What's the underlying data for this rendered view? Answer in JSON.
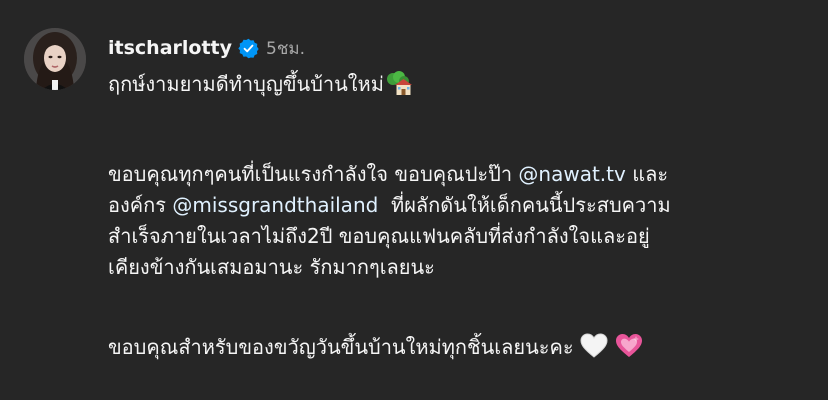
{
  "post": {
    "username": "itscharlotty",
    "timestamp": "5ชม.",
    "line1": "ฤกษ์งามยามดีทำบุญขึ้นบ้านใหม่",
    "line1_emoji": "house-with-garden-emoji",
    "para2": {
      "l1_text": "ขอบคุณทุกๆคนที่เป็นแรงกำลังใจ ขอบคุณปะป๊า ",
      "l1_mention": "@nawat.tv",
      "l1_suffix": " และ",
      "l2_prefix": "องค์กร ",
      "l2_mention": "@missgrandthailand",
      "l2_suffix": "  ที่ผลักดันให้เด็กคนนี้ประสบความ",
      "l3": "สำเร็จภายในเวลาไม่ถึง2ปี ขอบคุณแฟนคลับที่ส่งกำลังใจและอยู่",
      "l4": "เคียงข้างกันเสมอมานะ รักมากๆเลยนะ"
    },
    "para3": {
      "text": "ขอบคุณสำหรับของขวัญวันขึ้นบ้านใหม่ทุกชิ้นเลยนะคะ",
      "emojis": [
        "white-heart-emoji",
        "sparkling-heart-emoji"
      ]
    }
  },
  "colors": {
    "background": "#262626",
    "text": "#f5f5f5",
    "muted": "#a8a8a8",
    "mention": "#e0f1ff",
    "verified": "#0095f6"
  }
}
